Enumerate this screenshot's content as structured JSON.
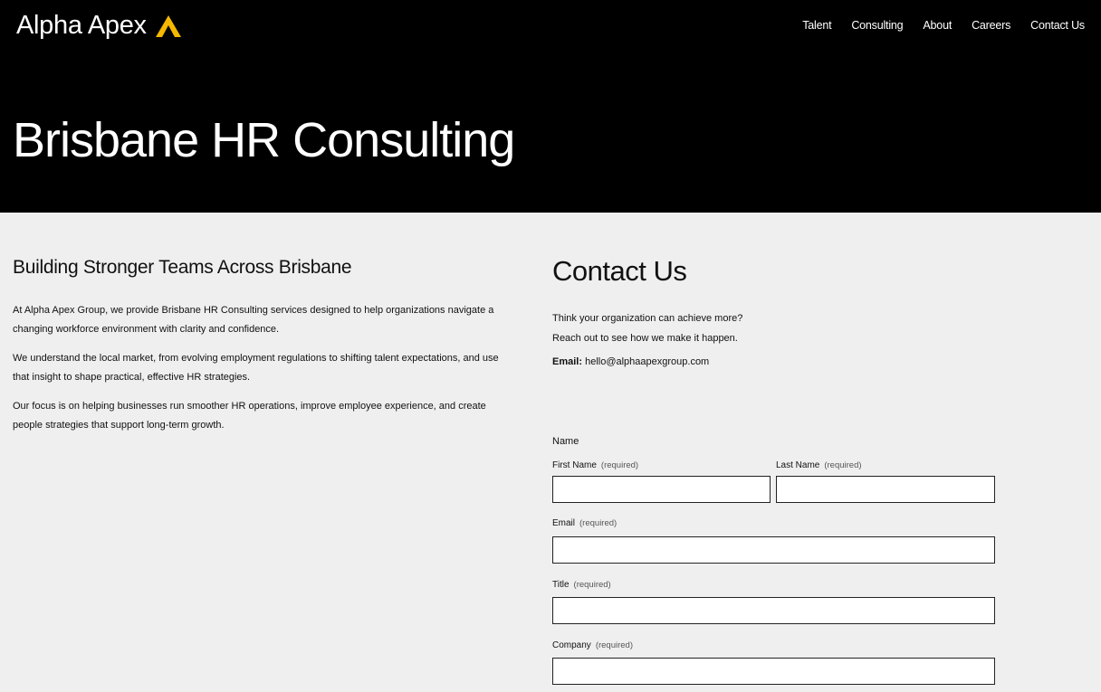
{
  "brand": {
    "name": "Alpha Apex",
    "accent_color": "#f5b800",
    "logo_icon": "apex-chevron-icon"
  },
  "nav": {
    "items": [
      {
        "label": "Talent"
      },
      {
        "label": "Consulting"
      },
      {
        "label": "About"
      },
      {
        "label": "Careers"
      },
      {
        "label": "Contact Us"
      }
    ]
  },
  "hero": {
    "title": "Brisbane HR Consulting"
  },
  "about": {
    "heading": "Building Stronger Teams Across Brisbane",
    "paragraphs": [
      "At Alpha Apex Group, we provide Brisbane HR Consulting services designed to help organizations navigate a changing workforce environment with clarity and confidence.",
      "We understand the local market, from evolving employment regulations to shifting talent expectations, and use that insight to shape practical, effective HR strategies.",
      "Our focus is on helping businesses run smoother HR operations, improve employee experience, and create people strategies that support long-term growth."
    ]
  },
  "contact": {
    "heading": "Contact Us",
    "intro_line1": "Think your organization can achieve more?",
    "intro_line2": "Reach out to see how we make it happen.",
    "email_label": "Email:",
    "email_value": "hello@alphaapexgroup.com"
  },
  "form": {
    "name_label": "Name",
    "required_text": "(required)",
    "first_name_label": "First Name",
    "last_name_label": "Last Name",
    "email_label": "Email",
    "title_label": "Title",
    "company_label": "Company",
    "first_name_value": "",
    "last_name_value": "",
    "email_value": "",
    "title_value": "",
    "company_value": ""
  }
}
